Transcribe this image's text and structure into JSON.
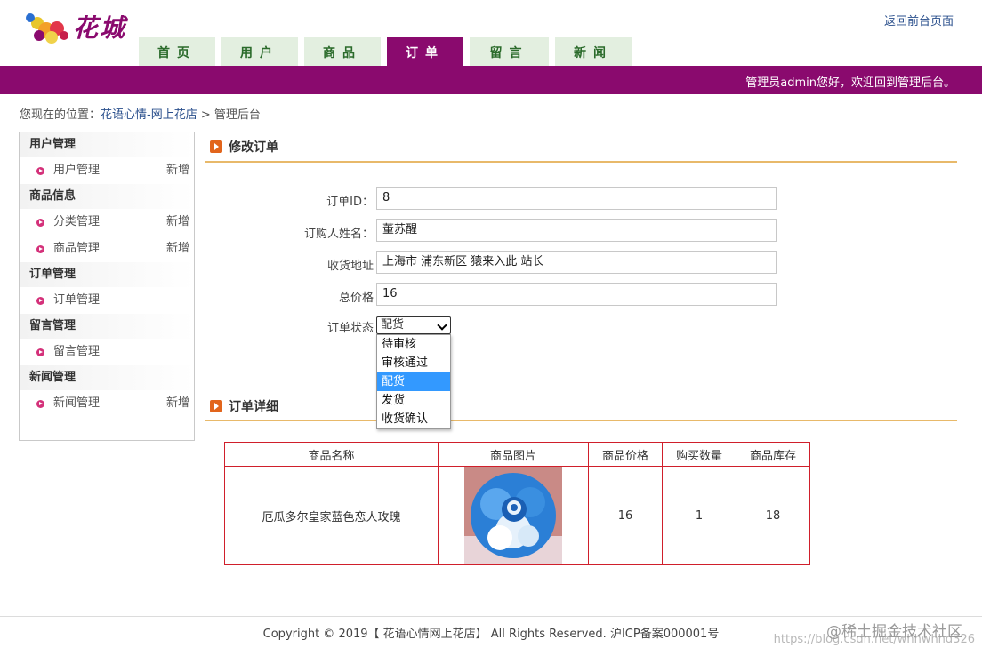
{
  "header": {
    "logo_text": "花城",
    "return_link": "返回前台页面",
    "welcome": "管理员admin您好，欢迎回到管理后台。"
  },
  "nav": {
    "tabs": [
      {
        "label": "首页"
      },
      {
        "label": "用户"
      },
      {
        "label": "商品"
      },
      {
        "label": "订单"
      },
      {
        "label": "留言"
      },
      {
        "label": "新闻"
      }
    ],
    "active": "订单"
  },
  "breadcrumb": {
    "prefix": "您现在的位置：",
    "site": "花语心情-网上花店",
    "separator": " > ",
    "current": "管理后台"
  },
  "sidebar": {
    "add_label": "新增",
    "groups": [
      {
        "title": "用户管理",
        "items": [
          {
            "label": "用户管理"
          }
        ]
      },
      {
        "title": "商品信息",
        "items": [
          {
            "label": "分类管理"
          },
          {
            "label": "商品管理"
          }
        ]
      },
      {
        "title": "订单管理",
        "items": [
          {
            "label": "订单管理"
          }
        ]
      },
      {
        "title": "留言管理",
        "items": [
          {
            "label": "留言管理"
          }
        ]
      },
      {
        "title": "新闻管理",
        "items": [
          {
            "label": "新闻管理"
          }
        ]
      }
    ]
  },
  "form": {
    "title": "修改订单",
    "fields": [
      {
        "label": "订单ID：",
        "value": "8"
      },
      {
        "label": "订购人姓名：",
        "value": "董苏醒"
      },
      {
        "label": "收货地址",
        "value": "上海市 浦东新区 猿来入此 站长"
      },
      {
        "label": "总价格",
        "value": "16"
      }
    ],
    "status_label": "订单状态",
    "status_value": "配货",
    "status_options": [
      "待审核",
      "审核通过",
      "配货",
      "发货",
      "收货确认"
    ]
  },
  "detail": {
    "title": "订单详细",
    "headers": [
      "商品名称",
      "商品图片",
      "商品价格",
      "购买数量",
      "商品库存"
    ],
    "row": {
      "name": "厄瓜多尔皇家蓝色恋人玫瑰",
      "price": "16",
      "quantity": "1",
      "stock": "18"
    }
  },
  "footer": {
    "copyright": "Copyright © 2019【 花语心情网上花店】 All Rights Reserved. 沪ICP备案000001号",
    "watermark": "@稀土掘金技术社区",
    "watermark_url": "https://blog.csdn.net/whhwhhd326"
  },
  "colors": {
    "brand": "#8a0a6e",
    "nav_tab_bg": "#e3efe0",
    "section_line": "#e8b96a",
    "table_border": "#d01f2b",
    "dropdown_selected": "#3399ff"
  }
}
